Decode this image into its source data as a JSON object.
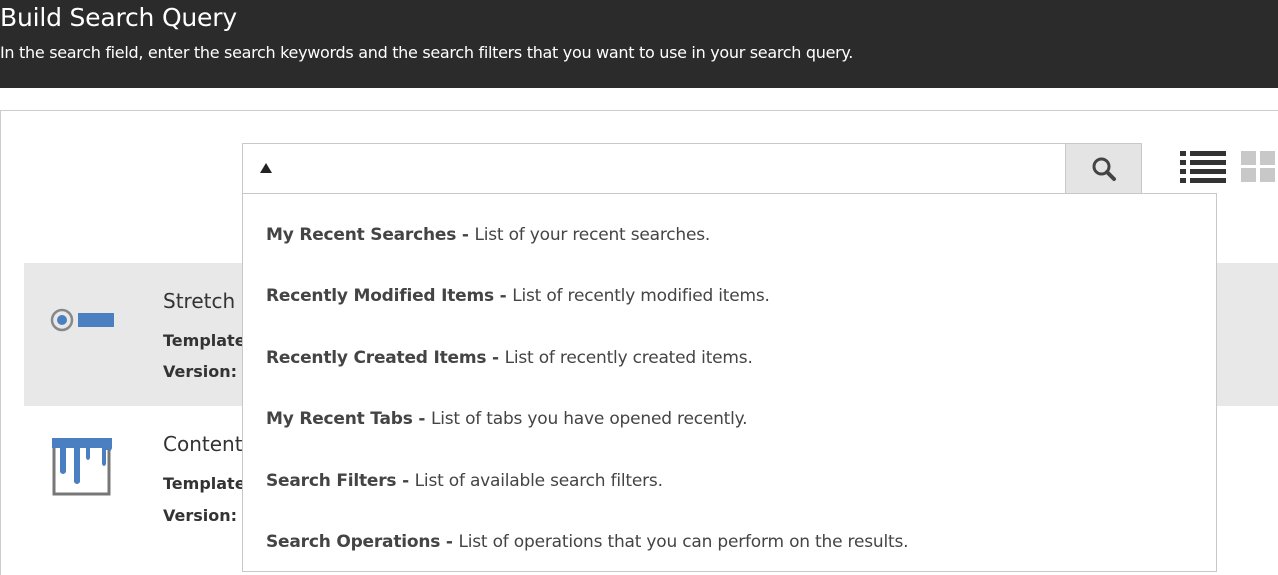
{
  "header": {
    "title": "Build Search Query",
    "description": "In the search field, enter the search keywords and the search filters that you want to use in your search query."
  },
  "search": {
    "value": "",
    "placeholder": ""
  },
  "items": [
    {
      "title": "Stretch",
      "template_label": "Template",
      "version_label": "Version:"
    },
    {
      "title": "Content",
      "template_label": "Template",
      "version_label": "Version:"
    }
  ],
  "dropdown": {
    "items": [
      {
        "label": "My Recent Searches - ",
        "description": "List of your recent searches."
      },
      {
        "label": "Recently Modified Items - ",
        "description": "List of recently modified items."
      },
      {
        "label": "Recently Created Items - ",
        "description": "List of recently created items."
      },
      {
        "label": "My Recent Tabs - ",
        "description": "List of tabs you have opened recently."
      },
      {
        "label": "Search Filters - ",
        "description": "List of available search filters."
      },
      {
        "label": "Search Operations - ",
        "description": "List of operations that you can perform on the results."
      }
    ]
  },
  "colors": {
    "header_bg": "#2b2b2b",
    "accent_blue": "#4a7fc1",
    "selected_row": "#e8e8e8"
  }
}
